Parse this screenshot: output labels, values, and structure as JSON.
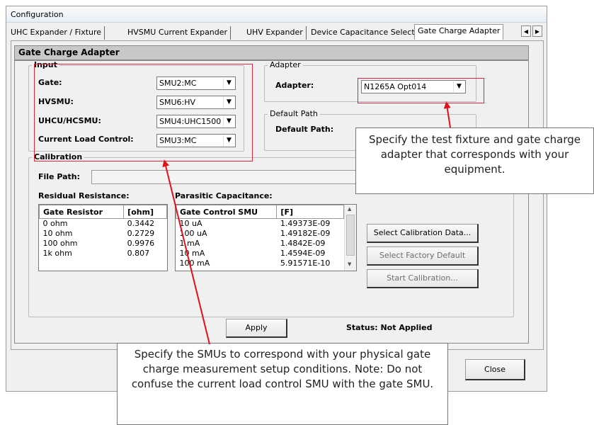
{
  "window": {
    "title": "Configuration"
  },
  "tabs": [
    "UHC Expander / Fixture",
    "HVSMU Current Expander",
    "UHV Expander",
    "Device Capacitance Selector",
    "Gate Charge Adapter"
  ],
  "panel": {
    "header": "Gate Charge Adapter"
  },
  "input_group": {
    "title": "Input",
    "rows": [
      {
        "label": "Gate:",
        "value": "SMU2:MC"
      },
      {
        "label": "HVSMU:",
        "value": "SMU6:HV"
      },
      {
        "label": "UHCU/HCSMU:",
        "value": "SMU4:UHC1500"
      },
      {
        "label": "Current Load Control:",
        "value": "SMU3:MC"
      }
    ]
  },
  "adapter_group": {
    "title": "Adapter",
    "label": "Adapter:",
    "value": "N1265A Opt014"
  },
  "default_path_group": {
    "title": "Default Path",
    "label": "Default Path:"
  },
  "calibration": {
    "title": "Calibration",
    "file_path_label": "File Path:",
    "residual_label": "Residual Resistance:",
    "parasitic_label": "Parasitic Capacitance:",
    "residual_headers": [
      "Gate Resistor",
      "[ohm]"
    ],
    "residual_rows": [
      [
        "0 ohm",
        "0.3442"
      ],
      [
        "10 ohm",
        "0.2729"
      ],
      [
        "100 ohm",
        "0.9976"
      ],
      [
        "1k ohm",
        "0.807"
      ]
    ],
    "parasitic_headers": [
      "Gate Control SMU",
      "[F]"
    ],
    "parasitic_rows": [
      [
        "10 uA",
        "1.49373E-09"
      ],
      [
        "100 uA",
        "1.49182E-09"
      ],
      [
        "1 mA",
        "1.4842E-09"
      ],
      [
        "10 mA",
        "1.4594E-09"
      ],
      [
        "100 mA",
        "5.91571E-10"
      ]
    ],
    "buttons": {
      "select_data": "Select Calibration Data...",
      "factory_default": "Select Factory Default",
      "start": "Start Calibration..."
    }
  },
  "apply_label": "Apply",
  "status_text": "Status: Not Applied",
  "close_label": "Close",
  "callouts": {
    "adapter": "Specify the test fixture and gate charge adapter that corresponds with your equipment.",
    "smu": "Specify the SMUs to correspond with your physical gate charge measurement setup conditions. Note: Do not confuse the current load control SMU with the gate SMU."
  },
  "colors": {
    "highlight": "#d6283a",
    "arrow": "#e0101e"
  }
}
